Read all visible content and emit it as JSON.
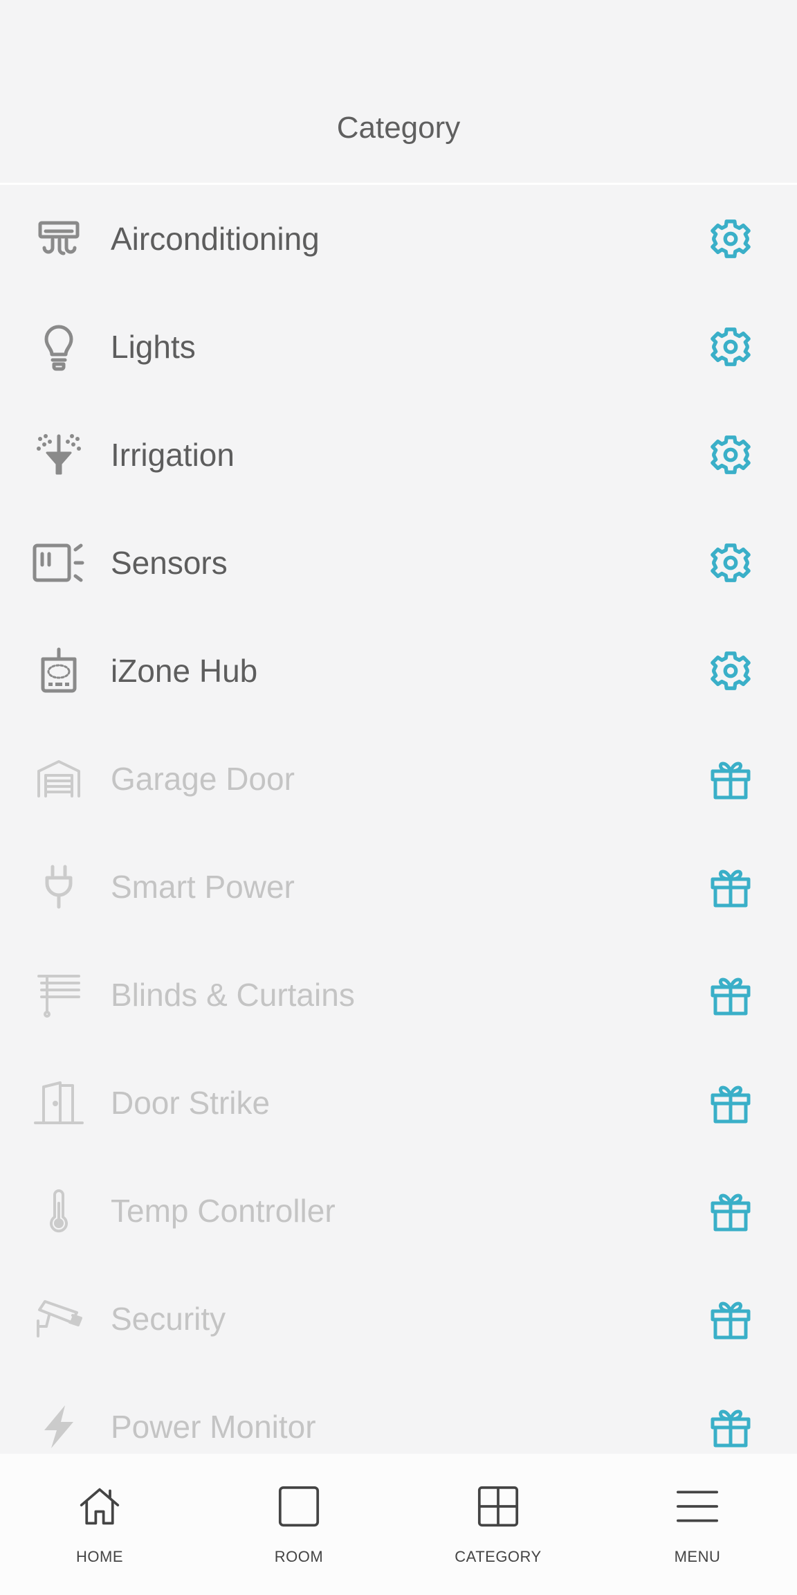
{
  "header": {
    "title": "Category"
  },
  "categories": [
    {
      "label": "Airconditioning",
      "icon": "aircon-icon",
      "action": "gear-icon",
      "enabled": true
    },
    {
      "label": "Lights",
      "icon": "bulb-icon",
      "action": "gear-icon",
      "enabled": true
    },
    {
      "label": "Irrigation",
      "icon": "sprinkler-icon",
      "action": "gear-icon",
      "enabled": true
    },
    {
      "label": "Sensors",
      "icon": "sensor-icon",
      "action": "gear-icon",
      "enabled": true
    },
    {
      "label": "iZone Hub",
      "icon": "hub-icon",
      "action": "gear-icon",
      "enabled": true
    },
    {
      "label": "Garage Door",
      "icon": "garage-icon",
      "action": "gift-icon",
      "enabled": false
    },
    {
      "label": "Smart Power",
      "icon": "plug-icon",
      "action": "gift-icon",
      "enabled": false
    },
    {
      "label": "Blinds & Curtains",
      "icon": "blinds-icon",
      "action": "gift-icon",
      "enabled": false
    },
    {
      "label": "Door Strike",
      "icon": "door-icon",
      "action": "gift-icon",
      "enabled": false
    },
    {
      "label": "Temp Controller",
      "icon": "thermometer-icon",
      "action": "gift-icon",
      "enabled": false
    },
    {
      "label": "Security",
      "icon": "camera-icon",
      "action": "gift-icon",
      "enabled": false
    },
    {
      "label": "Power Monitor",
      "icon": "lightning-icon",
      "action": "gift-icon",
      "enabled": false
    }
  ],
  "nav": {
    "home": "HOME",
    "room": "ROOM",
    "category": "CATEGORY",
    "menu": "MENU"
  },
  "colors": {
    "accent": "#3aafc8",
    "icon_active": "#8a8a8a",
    "icon_disabled": "#cbcbcb",
    "text_active": "#5d5d5d",
    "text_disabled": "#c4c4c4",
    "background": "#f4f4f5"
  }
}
